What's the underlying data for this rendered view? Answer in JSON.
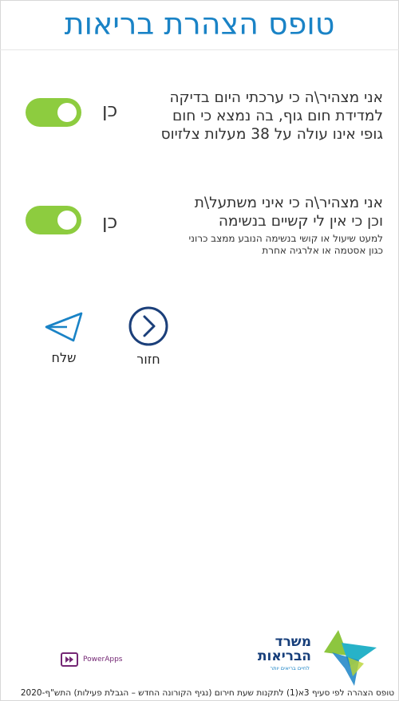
{
  "page": {
    "title": "טופס הצהרת בריאות"
  },
  "declarations": [
    {
      "lines": [
        "אני מצהיר\\ה כי ערכתי היום בדיקה",
        "למדידת חום גוף, בה נמצא כי חום",
        "גופי אינו עולה על 38 מעלות צלזיוס"
      ],
      "toggle_label": "כן",
      "toggle_on": true
    },
    {
      "lines": [
        "אני מצהיר\\ה כי איני משתעל\\ת",
        "וכן כי אין לי קשיים בנשימה"
      ],
      "note_lines": [
        "למעט שיעול או קושי בנשימה הנובע ממצב כרוני",
        "כגון אסטמה או אלרגיה אחרת"
      ],
      "toggle_label": "כן",
      "toggle_on": true
    }
  ],
  "actions": {
    "back_label": "חזור",
    "send_label": "שלח"
  },
  "footer": {
    "legal_text": "טופס הצהרה לפי סעיף 3א(1) לתקנות שעת חירום (נגיף הקורונה החדש – הגבלת פעילות) התש\"ף-2020",
    "powerapps_label": "PowerApps",
    "ministry_name_line1": "משרד",
    "ministry_name_line2": "הבריאות",
    "ministry_slogan": "לחיים בריאים יותר"
  },
  "colors": {
    "title": "#1a83c6",
    "toggle_on": "#8dcc3f",
    "icon_blue": "#1a83c6",
    "icon_navy": "#1b3f7a"
  },
  "icons": {
    "back": "chevron-right-circle-icon",
    "send": "paper-plane-icon",
    "powerapps": "powerapps-logo-icon",
    "ministry": "ministry-of-health-logo"
  }
}
